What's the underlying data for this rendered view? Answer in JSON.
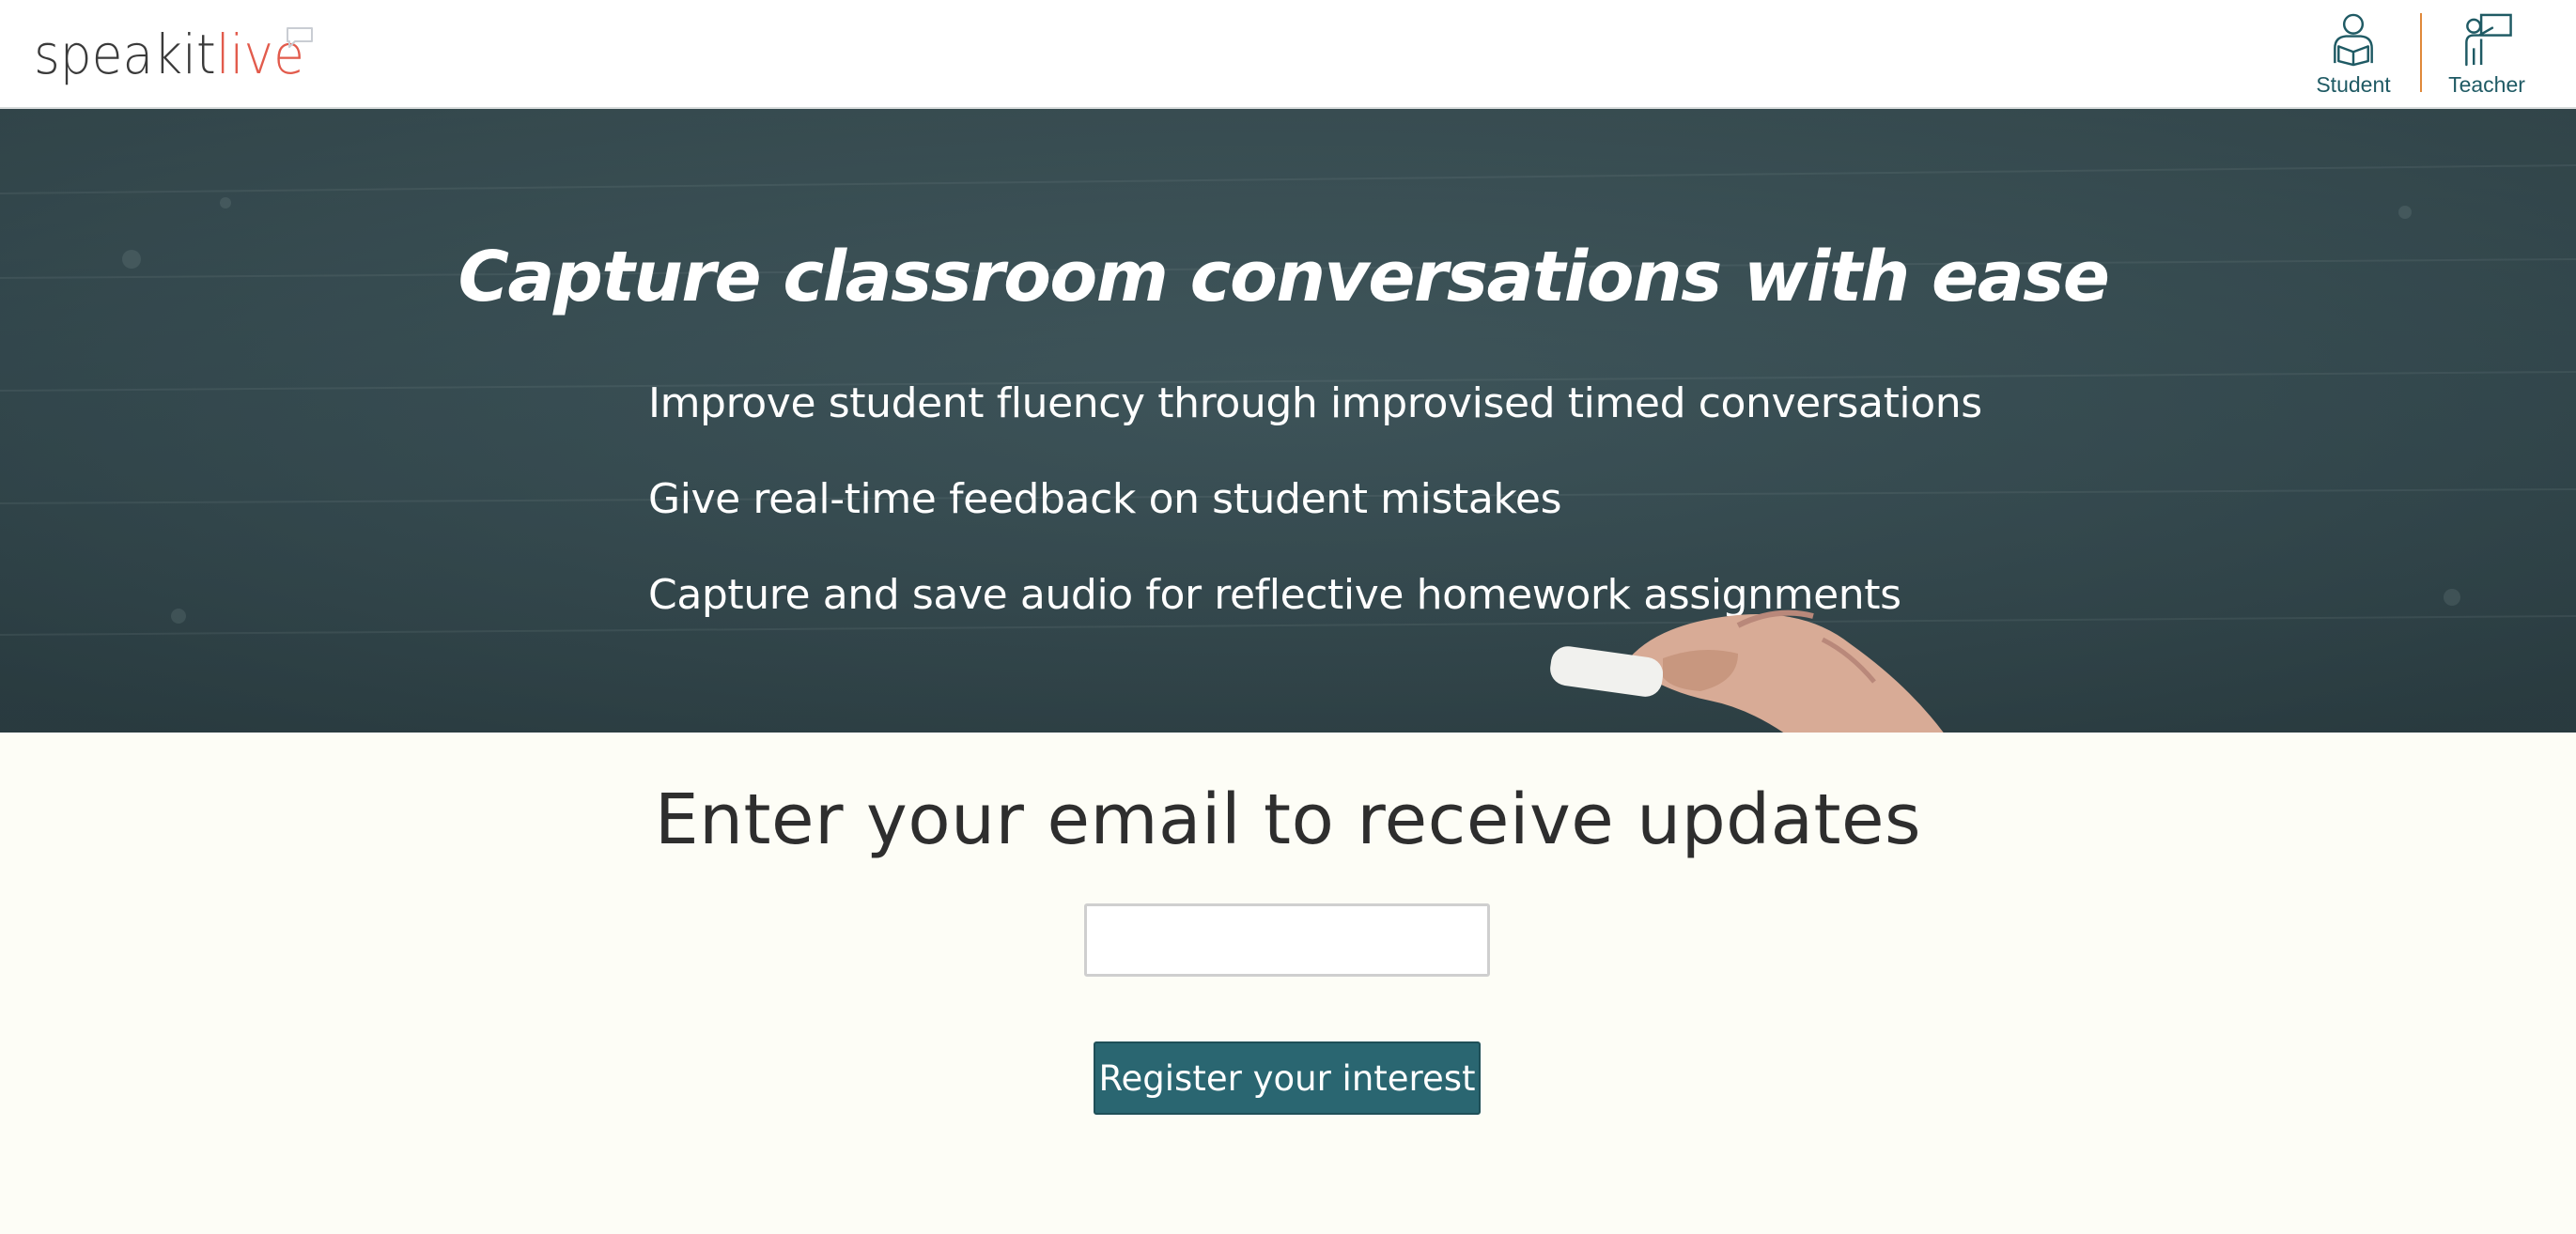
{
  "header": {
    "logo": {
      "part1": "speakit",
      "part2": "live"
    },
    "nav": [
      {
        "label": "Student",
        "icon": "student-icon"
      },
      {
        "label": "Teacher",
        "icon": "teacher-icon"
      }
    ]
  },
  "hero": {
    "title": "Capture classroom conversations with ease",
    "bullets": [
      "Improve student fluency through improvised timed conversations",
      "Give real-time feedback on student mistakes",
      "Capture and save audio for reflective homework assignments"
    ]
  },
  "signup": {
    "title": "Enter your email to receive updates",
    "email_value": "",
    "email_placeholder": "",
    "button_label": "Register your interest"
  },
  "colors": {
    "accent": "#e25b4c",
    "brand_teal": "#2a6671",
    "divider_orange": "#e0893a",
    "hero_bg": "#364c52",
    "page_bg": "#fdfdf6"
  }
}
